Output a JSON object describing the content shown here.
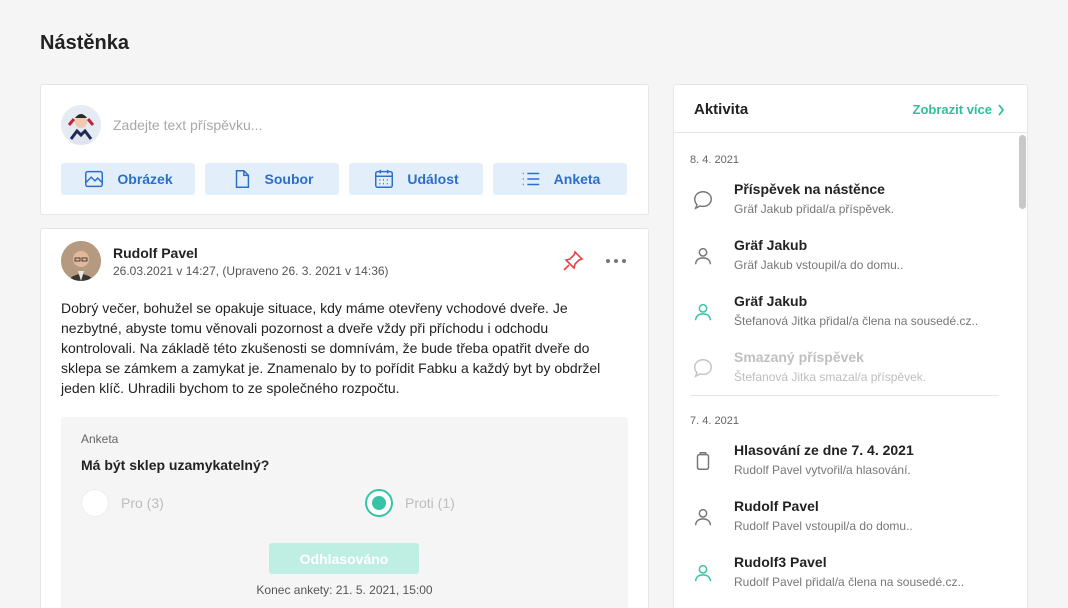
{
  "page": {
    "title": "Nástěnka"
  },
  "composer": {
    "placeholder": "Zadejte text příspěvku...",
    "buttons": [
      {
        "label": "Obrázek",
        "icon": "image-icon"
      },
      {
        "label": "Soubor",
        "icon": "file-icon"
      },
      {
        "label": "Událost",
        "icon": "calendar-icon"
      },
      {
        "label": "Anketa",
        "icon": "list-icon"
      }
    ]
  },
  "post": {
    "author": "Rudolf Pavel",
    "meta": "26.03.2021 v 14:27, (Upraveno 26. 3. 2021 v 14:36)",
    "body": "Dobrý večer, bohužel se opakuje situace, kdy máme otevřeny vchodové dveře. Je nezbytné, abyste tomu věnovali pozornost a dveře vždy při příchodu i odchodu kontrolovali. Na základě této zkušenosti se domnívám, že bude třeba opatřit dveře do sklepa se zámkem a zamykat je. Znamenalo by to pořídit Fabku a každý byt by obdržel jeden klíč. Uhradili bychom to ze společného rozpočtu.",
    "poll": {
      "label": "Anketa",
      "question": "Má být sklep uzamykatelný?",
      "options": [
        {
          "label": "Pro (3)",
          "selected": false
        },
        {
          "label": "Proti (1)",
          "selected": true
        }
      ],
      "voted_label": "Odhlasováno",
      "end": "Konec ankety: 21. 5. 2021, 15:00"
    }
  },
  "activity": {
    "title": "Aktivita",
    "more_label": "Zobrazit více",
    "groups": [
      {
        "date": "8. 4. 2021",
        "items": [
          {
            "title": "Příspěvek na nástěnce",
            "subtitle": "Gräf Jakub přidal/a příspěvek.",
            "icon": "comment-icon",
            "dim": false
          },
          {
            "title": "Gräf Jakub",
            "subtitle": "Gräf Jakub vstoupil/a do domu..",
            "icon": "user-icon",
            "dim": false
          },
          {
            "title": "Gräf Jakub",
            "subtitle": "Štefanová Jitka přidal/a člena na sousedé.cz..",
            "icon": "user-add-icon",
            "dim": false
          },
          {
            "title": "Smazaný příspěvek",
            "subtitle": "Štefanová Jitka smazal/a příspěvek.",
            "icon": "comment-icon",
            "dim": true
          }
        ]
      },
      {
        "date": "7. 4. 2021",
        "items": [
          {
            "title": "Hlasování ze dne 7. 4. 2021",
            "subtitle": "Rudolf Pavel vytvořil/a hlasování.",
            "icon": "clipboard-icon",
            "dim": false
          },
          {
            "title": "Rudolf Pavel",
            "subtitle": "Rudolf Pavel vstoupil/a do domu..",
            "icon": "user-icon",
            "dim": false
          },
          {
            "title": "Rudolf3 Pavel",
            "subtitle": "Rudolf Pavel přidal/a člena na sousedé.cz..",
            "icon": "user-add-icon",
            "dim": false
          }
        ]
      }
    ]
  },
  "colors": {
    "accent": "#35c4a5",
    "link": "#2fbf9c",
    "button_bg": "#e3eefb",
    "button_text": "#2b6fc9",
    "pin": "#e8424b"
  }
}
